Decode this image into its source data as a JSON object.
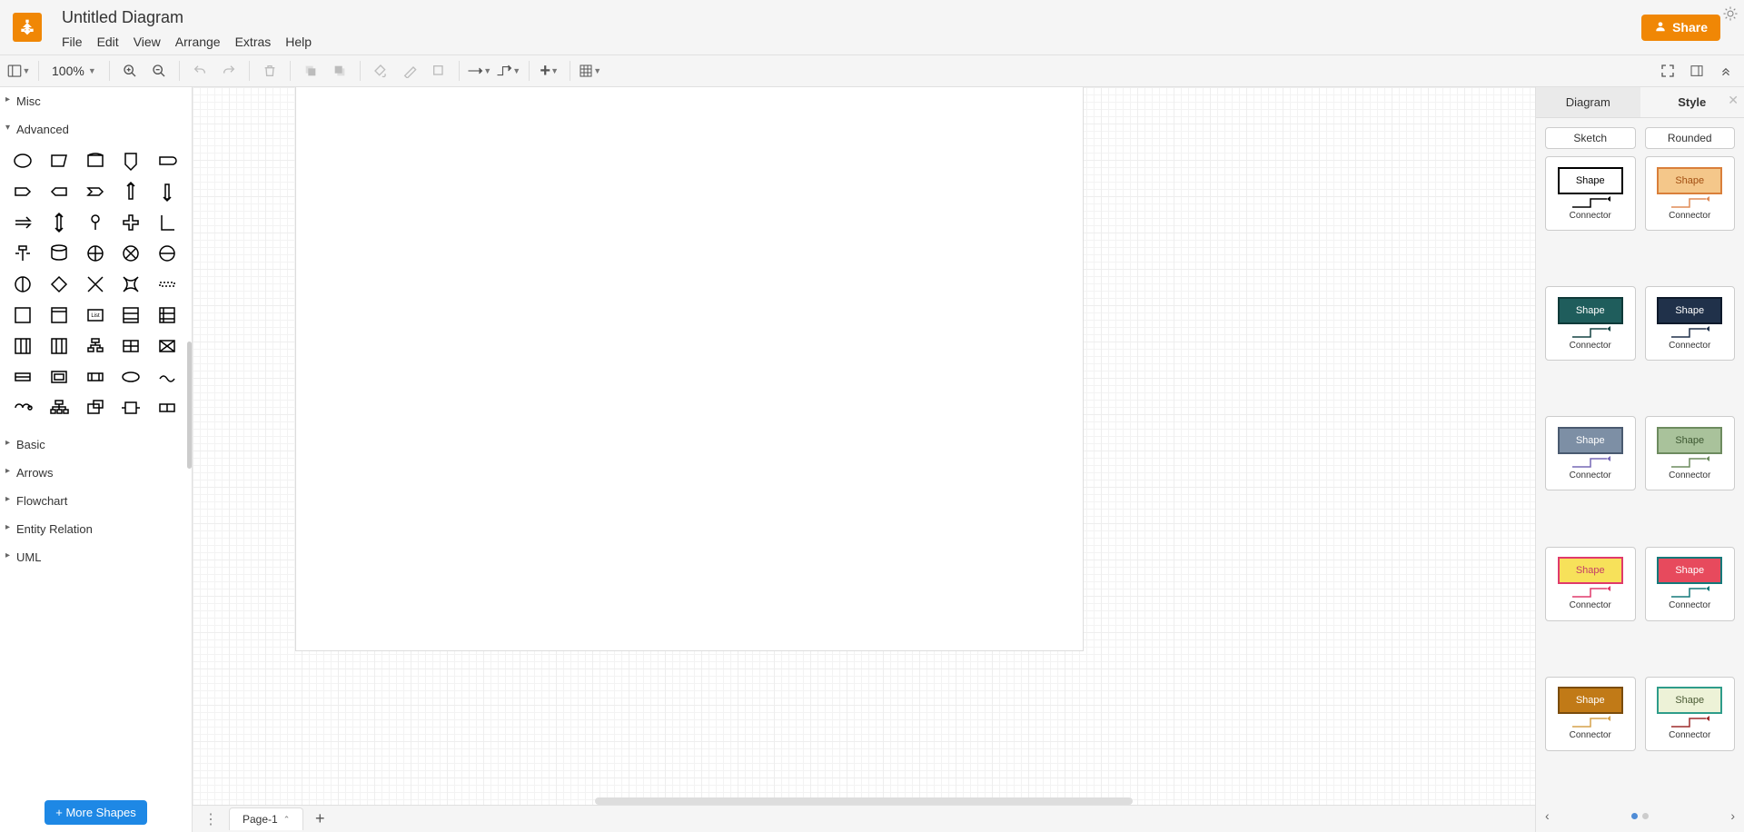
{
  "app": {
    "title": "Untitled Diagram"
  },
  "menu": {
    "file": "File",
    "edit": "Edit",
    "view": "View",
    "arrange": "Arrange",
    "extras": "Extras",
    "help": "Help"
  },
  "header": {
    "share": "Share"
  },
  "toolbar": {
    "zoom": "100%"
  },
  "sidebar": {
    "sections": {
      "misc": "Misc",
      "advanced": "Advanced",
      "basic": "Basic",
      "arrows": "Arrows",
      "flowchart": "Flowchart",
      "entity_relation": "Entity Relation",
      "uml": "UML"
    },
    "more_shapes": "+ More Shapes"
  },
  "pages": {
    "page1": "Page-1"
  },
  "right_panel": {
    "tabs": {
      "diagram": "Diagram",
      "style": "Style"
    },
    "toggles": {
      "sketch": "Sketch",
      "rounded": "Rounded"
    },
    "shape_label": "Shape",
    "connector_label": "Connector",
    "themes": [
      {
        "shape_bg": "#ffffff",
        "shape_border": "#000000",
        "shape_text": "#000000",
        "conn": "#000000"
      },
      {
        "shape_bg": "#f4c78a",
        "shape_border": "#d97f3a",
        "shape_text": "#a24f12",
        "conn": "#e08b57"
      },
      {
        "shape_bg": "#1f5d5c",
        "shape_border": "#0f3a39",
        "shape_text": "#ffffff",
        "conn": "#154443"
      },
      {
        "shape_bg": "#20314a",
        "shape_border": "#0e1a2b",
        "shape_text": "#ffffff",
        "conn": "#20314a"
      },
      {
        "shape_bg": "#7d8fa5",
        "shape_border": "#4a5a70",
        "shape_text": "#ffffff",
        "conn": "#7768b5"
      },
      {
        "shape_bg": "#a9c29b",
        "shape_border": "#6d8b5f",
        "shape_text": "#3d5731",
        "conn": "#6d8b5f"
      },
      {
        "shape_bg": "#f7e15a",
        "shape_border": "#e03a6b",
        "shape_text": "#c43d67",
        "conn": "#e03a6b"
      },
      {
        "shape_bg": "#e74a5d",
        "shape_border": "#14797a",
        "shape_text": "#ffffff",
        "conn": "#14797a"
      },
      {
        "shape_bg": "#c17a17",
        "shape_border": "#7a4c0d",
        "shape_text": "#ffffff",
        "conn": "#d6a24b"
      },
      {
        "shape_bg": "#edf2d7",
        "shape_border": "#2e9c8a",
        "shape_text": "#4a5a34",
        "conn": "#9e2b2b"
      }
    ]
  }
}
